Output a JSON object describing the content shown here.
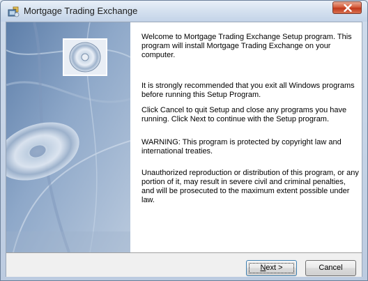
{
  "window": {
    "title": "Mortgage Trading Exchange"
  },
  "content": {
    "paragraphs": [
      "Welcome to Mortgage Trading Exchange Setup program. This program will install Mortgage Trading Exchange on your computer.",
      "It is strongly recommended that you exit all Windows programs before running this Setup Program.",
      "Click Cancel to quit Setup and close any programs you have running.  Click Next to continue with the Setup program.",
      "WARNING: This program is protected by copyright law and international treaties.",
      "Unauthorized reproduction or distribution of this program, or any portion of it, may result in severe civil and criminal penalties, and will be prosecuted to the maximum extent possible under law."
    ]
  },
  "buttons": {
    "next_mnemonic": "N",
    "next_rest": "ext >",
    "cancel": "Cancel"
  },
  "icons": {
    "app": "setup-installer-icon",
    "close": "close-icon",
    "banner_disc": "cd-disc-icon"
  },
  "colors": {
    "banner_blue": "#6f8fb8",
    "close_red": "#c0391c"
  }
}
